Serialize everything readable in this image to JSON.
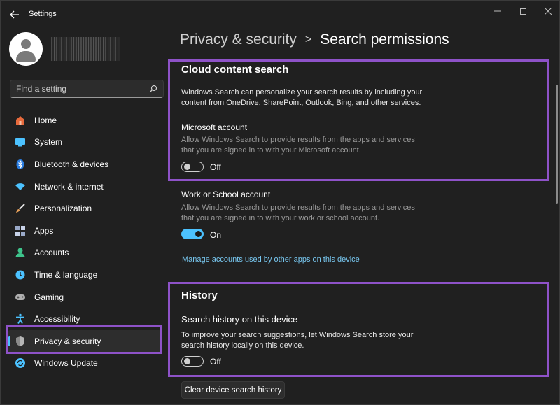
{
  "window": {
    "app_title": "Settings"
  },
  "profile": {
    "icon": "user-avatar"
  },
  "search": {
    "placeholder": "Find a setting"
  },
  "sidebar": {
    "items": [
      {
        "label": "Home",
        "icon": "home-icon",
        "color": "#e86a3c"
      },
      {
        "label": "System",
        "icon": "monitor-icon",
        "color": "#4cc2ff"
      },
      {
        "label": "Bluetooth & devices",
        "icon": "bluetooth-icon",
        "color": "#4c8dff"
      },
      {
        "label": "Network & internet",
        "icon": "wifi-icon",
        "color": "#4cc2ff"
      },
      {
        "label": "Personalization",
        "icon": "brush-icon",
        "color": "#e8a15a"
      },
      {
        "label": "Apps",
        "icon": "apps-icon",
        "color": "#9aa9c8"
      },
      {
        "label": "Accounts",
        "icon": "person-icon",
        "color": "#3ec48c"
      },
      {
        "label": "Time & language",
        "icon": "clock-globe-icon",
        "color": "#4cc2ff"
      },
      {
        "label": "Gaming",
        "icon": "gamepad-icon",
        "color": "#b0b0b0"
      },
      {
        "label": "Accessibility",
        "icon": "accessibility-icon",
        "color": "#4cc2ff"
      },
      {
        "label": "Privacy & security",
        "icon": "shield-icon",
        "color": "#9a9a9a"
      },
      {
        "label": "Windows Update",
        "icon": "update-icon",
        "color": "#4cc2ff"
      }
    ],
    "active_index": 10
  },
  "breadcrumb": {
    "parent": "Privacy & security",
    "separator": ">",
    "current": "Search permissions"
  },
  "cloud": {
    "title": "Cloud content search",
    "description_line1": "Windows Search can personalize your search results by including your",
    "description_line2": "content from OneDrive, SharePoint, Outlook, Bing, and other services.",
    "ms_account": {
      "label": "Microsoft account",
      "desc_line1": "Allow Windows Search to provide results from the apps and services",
      "desc_line2": "that you are signed in to with your Microsoft account.",
      "state": "Off"
    },
    "work_account": {
      "label": "Work or School account",
      "desc_line1": "Allow Windows Search to provide results from the apps and services",
      "desc_line2": "that you are signed in to with your work or school account.",
      "state": "On"
    },
    "manage_link": "Manage accounts used by other apps on this device"
  },
  "history": {
    "title": "History",
    "device_history": {
      "label": "Search history on this device",
      "desc_line1": "To improve your search suggestions, let Windows Search store your",
      "desc_line2": "search history locally on this device.",
      "state": "Off"
    },
    "clear_button": "Clear device search history"
  },
  "colors": {
    "accent": "#4cc2ff",
    "highlight_frame": "#8e52c8",
    "link": "#79c9f2"
  }
}
